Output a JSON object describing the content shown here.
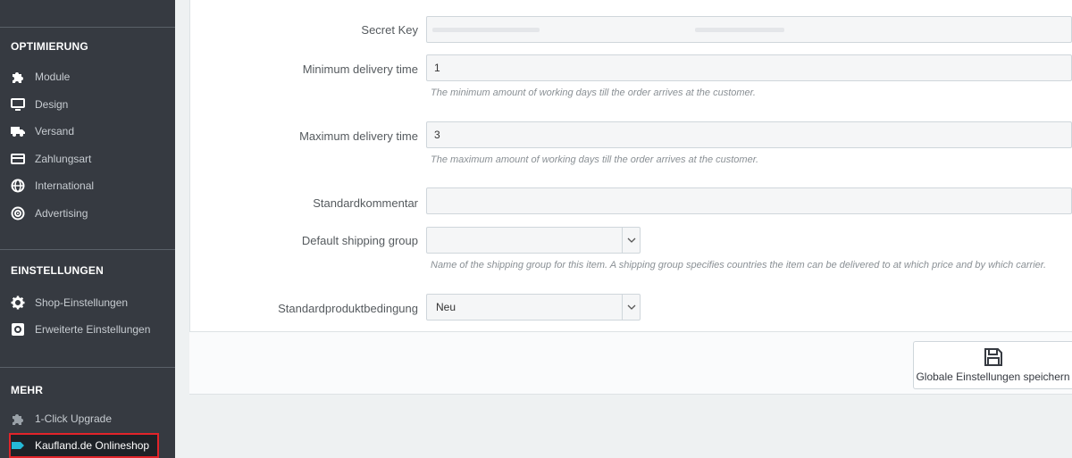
{
  "sidebar": {
    "sections": [
      {
        "title": "OPTIMIERUNG"
      },
      {
        "title": "EINSTELLUNGEN"
      },
      {
        "title": "MEHR"
      }
    ],
    "items": [
      {
        "label": "Module",
        "icon": "puzzle-icon"
      },
      {
        "label": "Design",
        "icon": "monitor-icon"
      },
      {
        "label": "Versand",
        "icon": "truck-icon"
      },
      {
        "label": "Zahlungsart",
        "icon": "credit-card-icon"
      },
      {
        "label": "International",
        "icon": "globe-icon"
      },
      {
        "label": "Advertising",
        "icon": "target-icon"
      },
      {
        "label": "Shop-Einstellungen",
        "icon": "gear-icon"
      },
      {
        "label": "Erweiterte Einstellungen",
        "icon": "settings-box-icon"
      },
      {
        "label": "1-Click Upgrade",
        "icon": "puzzle-icon"
      },
      {
        "label": "Kaufland.de Onlineshop",
        "icon": "tag-icon"
      }
    ],
    "colors": {
      "background": "#363a41",
      "active": "#1e2227",
      "highlight": "#e1242a"
    }
  },
  "form": {
    "secret_key": {
      "label": "Secret Key"
    },
    "min_delivery": {
      "label": "Minimum delivery time",
      "value": "1",
      "help": "The minimum amount of working days till the order arrives at the customer."
    },
    "max_delivery": {
      "label": "Maximum delivery time",
      "value": "3",
      "help": "The maximum amount of working days till the order arrives at the customer."
    },
    "standard_comment": {
      "label": "Standardkommentar",
      "value": ""
    },
    "shipping_group": {
      "label": "Default shipping group",
      "value": "",
      "help": "Name of the shipping group for this item. A shipping group specifies countries the item can be delivered to at which price and by which carrier."
    },
    "product_condition": {
      "label": "Standardproduktbedingung",
      "value": "Neu"
    }
  },
  "footer": {
    "save_label": "Globale Einstellungen speichern",
    "save_icon": "save-icon"
  }
}
